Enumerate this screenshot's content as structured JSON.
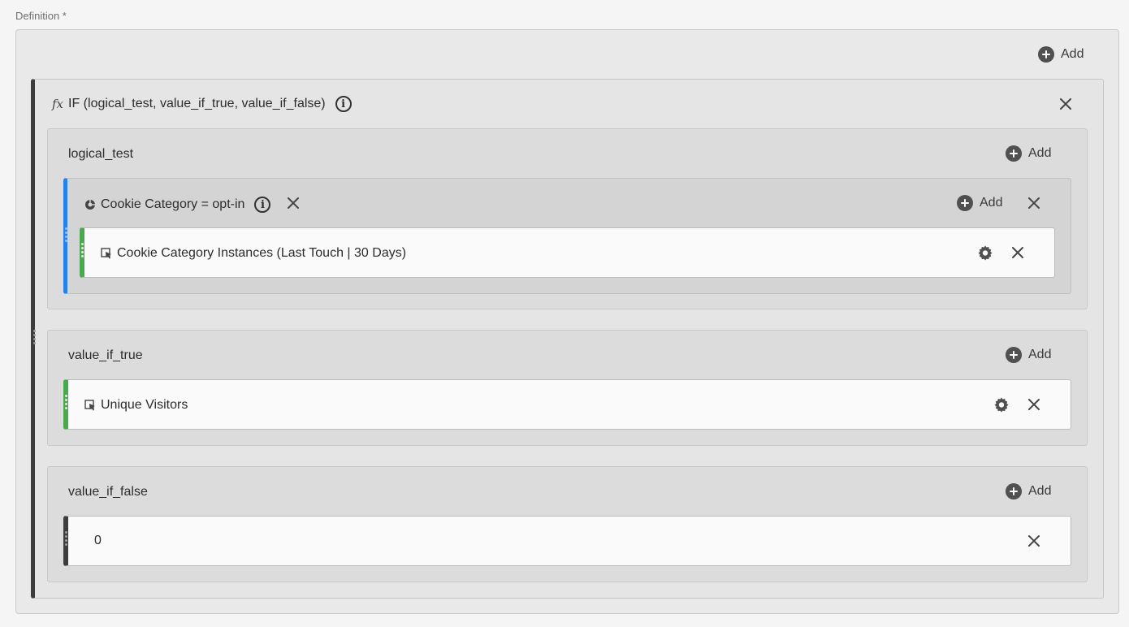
{
  "definition": {
    "label": "Definition *"
  },
  "top_add": {
    "label": "Add"
  },
  "if_block": {
    "fx_symbol": "fx",
    "title": "IF (logical_test, value_if_true, value_if_false)",
    "info": "i"
  },
  "logical_test": {
    "label": "logical_test",
    "add_label": "Add",
    "condition": {
      "label": "Cookie Category = opt-in",
      "add_label": "Add",
      "metric": "Cookie Category Instances (Last Touch | 30 Days)"
    }
  },
  "value_if_true": {
    "label": "value_if_true",
    "add_label": "Add",
    "metric": "Unique Visitors"
  },
  "value_if_false": {
    "label": "value_if_false",
    "add_label": "Add",
    "static_value": "0"
  },
  "colors": {
    "condition_accent": "#2680eb",
    "metric_accent": "#4aa84f",
    "static_accent": "#3d3d3d"
  }
}
